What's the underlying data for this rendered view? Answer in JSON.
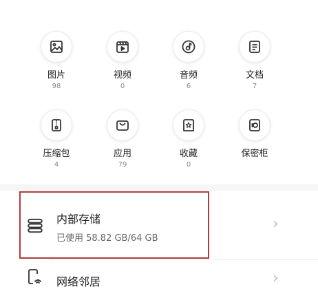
{
  "categories": [
    {
      "name": "图片",
      "count": "98",
      "icon": "image-icon"
    },
    {
      "name": "视频",
      "count": "0",
      "icon": "video-icon"
    },
    {
      "name": "音频",
      "count": "6",
      "icon": "audio-icon"
    },
    {
      "name": "文档",
      "count": "7",
      "icon": "document-icon"
    },
    {
      "name": "压缩包",
      "count": "4",
      "icon": "archive-icon"
    },
    {
      "name": "应用",
      "count": "79",
      "icon": "app-icon"
    },
    {
      "name": "收藏",
      "count": "0",
      "icon": "favorite-icon"
    },
    {
      "name": "保密柜",
      "count": "",
      "icon": "safe-icon"
    }
  ],
  "storage": {
    "title": "内部存储",
    "usage": "已使用 58.82 GB/64 GB",
    "icon": "storage-icon"
  },
  "network": {
    "title": "网络邻居",
    "icon": "network-neighbor-icon"
  },
  "colors": {
    "highlight": "#b23a3a",
    "icon": "#333333",
    "muted": "#8a8a8a"
  }
}
